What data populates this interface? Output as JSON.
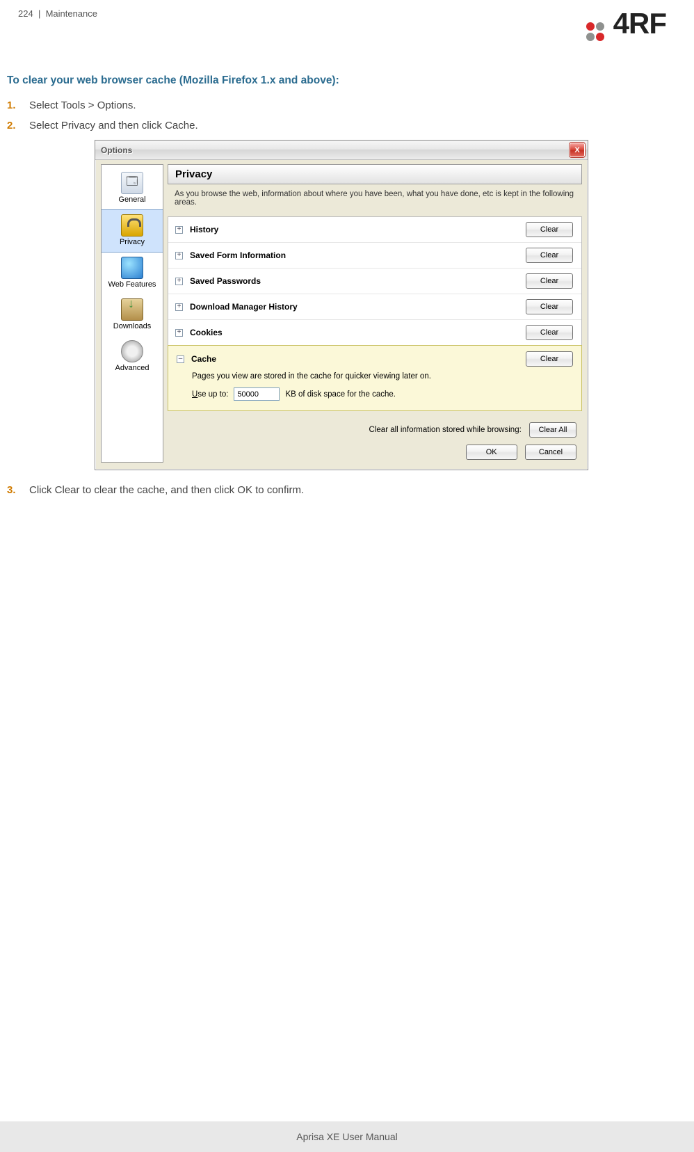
{
  "header": {
    "page_num": "224",
    "sep": "|",
    "section": "Maintenance"
  },
  "logo": {
    "text": "4RF"
  },
  "heading": "To clear your web browser cache (Mozilla Firefox 1.x and above):",
  "steps": {
    "s1_num": "1.",
    "s1": "Select Tools > Options.",
    "s2_num": "2.",
    "s2": "Select Privacy and then click Cache.",
    "s3_num": "3.",
    "s3": "Click Clear to clear the cache, and then click OK to confirm."
  },
  "dialog": {
    "title": "Options",
    "close": "X",
    "sidebar": {
      "general": "General",
      "privacy": "Privacy",
      "web": "Web Features",
      "down": "Downloads",
      "adv": "Advanced"
    },
    "panel_title": "Privacy",
    "description": "As you browse the web, information about where you have been, what you have done, etc is kept in the following areas.",
    "sections": {
      "history": "History",
      "forms": "Saved Form Information",
      "pw": "Saved Passwords",
      "dmh": "Download Manager History",
      "cookies": "Cookies"
    },
    "cache": {
      "title": "Cache",
      "desc": "Pages you view are stored in the cache for quicker viewing later on.",
      "use_pre": "U",
      "use_post": "se up to:",
      "value": "50000",
      "unit": "KB of disk space for the cache."
    },
    "clear_label": "Clear",
    "clear_all_pre": "Clear all information stored while browsing:",
    "clear_all": "Clear All",
    "ok": "OK",
    "cancel": "Cancel",
    "expand_plus": "+",
    "expand_minus": "–"
  },
  "footer": "Aprisa XE User Manual"
}
